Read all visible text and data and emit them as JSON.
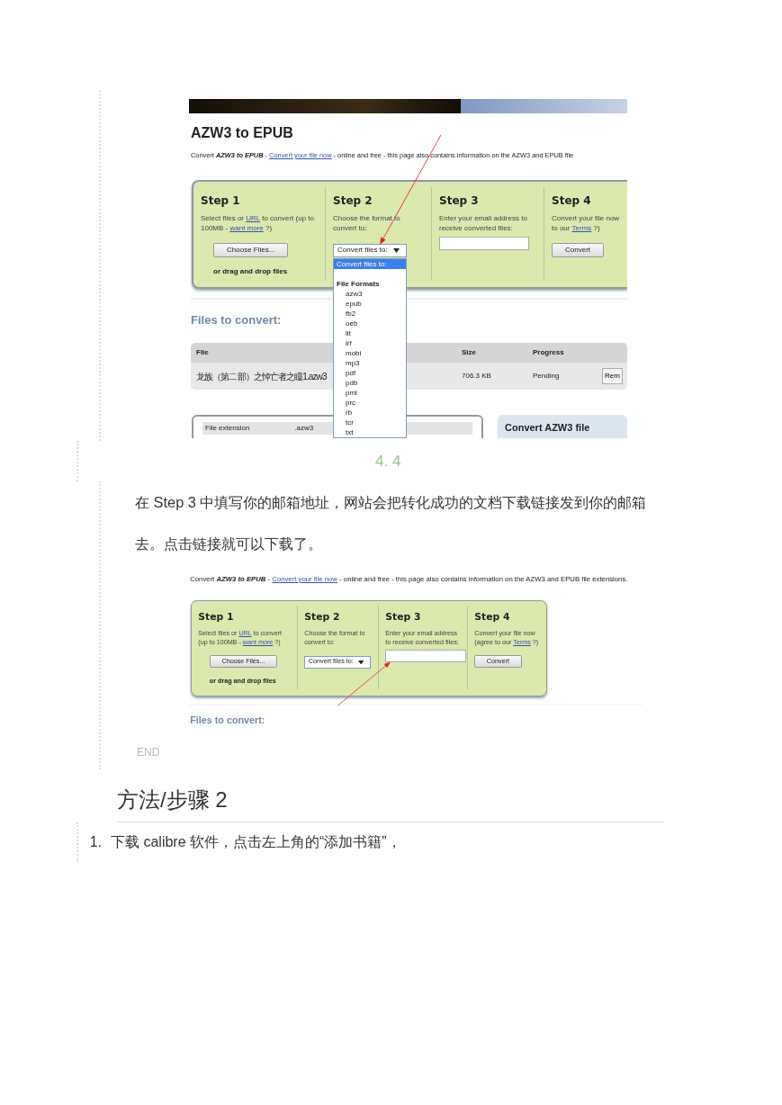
{
  "screenshot_1": {
    "title": "AZW3 to EPUB",
    "intro": {
      "before": "Convert **AZW3 to EPUB** - ",
      "link": "Convert your file now",
      "after": " - online and free - this page also contains information on the AZW3 and EPUB file"
    },
    "steps": [
      {
        "title": "Step 1",
        "text": [
          {
            "text": "Select files or ",
            "kind": "plain"
          },
          {
            "text": "URL",
            "kind": "link"
          },
          {
            "text": " to convert (up to 100MB - ",
            "kind": "plain"
          },
          {
            "text": "want more",
            "kind": "link"
          },
          {
            "text": " ?)",
            "kind": "plain"
          }
        ],
        "control": {
          "kind": "button",
          "label": "Choose Files..."
        },
        "note": "or drag and drop files"
      },
      {
        "title": "Step 2",
        "text": [
          {
            "text": "Choose the format to convert to:",
            "kind": "plain"
          }
        ],
        "control": {
          "kind": "select",
          "value": "Convert files to:"
        }
      },
      {
        "title": "Step 3",
        "text": [
          {
            "text": "Enter your email address to receive converted files:",
            "kind": "plain"
          }
        ],
        "control": {
          "kind": "input"
        }
      },
      {
        "title": "Step 4",
        "text": [
          {
            "text": "Convert your file now to our ",
            "kind": "plain"
          },
          {
            "text": "Terms",
            "kind": "link"
          },
          {
            "text": " ?)",
            "kind": "plain"
          }
        ],
        "control": {
          "kind": "button",
          "label": "Convert"
        }
      }
    ],
    "dropdown": {
      "items": [
        {
          "kind": "option",
          "label": "Convert files to:",
          "selected": true
        },
        {
          "kind": "group",
          "label": "File Formats"
        },
        {
          "kind": "format",
          "label": "azw3",
          "selected": false
        },
        {
          "kind": "format",
          "label": "epub",
          "selected": false
        },
        {
          "kind": "format",
          "label": "fb2",
          "selected": false
        },
        {
          "kind": "format",
          "label": "oeb",
          "selected": false
        },
        {
          "kind": "format",
          "label": "lit",
          "selected": false
        },
        {
          "kind": "format",
          "label": "lrf",
          "selected": false
        },
        {
          "kind": "format",
          "label": "mobi",
          "selected": false
        },
        {
          "kind": "format",
          "label": "mp3",
          "selected": false
        },
        {
          "kind": "format",
          "label": "pdf",
          "selected": false
        },
        {
          "kind": "format",
          "label": "pdb",
          "selected": false
        },
        {
          "kind": "format",
          "label": "pml",
          "selected": false
        },
        {
          "kind": "format",
          "label": "prc",
          "selected": false
        },
        {
          "kind": "format",
          "label": "rb",
          "selected": false
        },
        {
          "kind": "format",
          "label": "tcr",
          "selected": false
        },
        {
          "kind": "format",
          "label": "txt",
          "selected": false
        }
      ]
    },
    "files_heading": "Files to convert:",
    "table": {
      "columns": [
        "File",
        "Size",
        "Progress"
      ],
      "rows": [
        {
          "file": "龙族（第二部）之悼亡者之瞳1.azw3",
          "size": "706.3 KB",
          "progress": "Pending",
          "action": "Rem"
        }
      ]
    },
    "details": {
      "label": "File extension",
      "value": ".azw3"
    },
    "side_box_title": "Convert AZW3 file"
  },
  "step_label": "4. 4",
  "paragraph": "在 Step 3  中填写你的邮箱地址，网站会把转化成功的文档下载链接发到你的邮箱去。点击链接就可以下载了。",
  "screenshot_2": {
    "intro": {
      "before": "Convert **AZW3 to EPUB** - ",
      "link": "Convert your file now",
      "after": " - online and free - this page also contains information on the AZW3 and EPUB file extensions."
    },
    "steps": [
      {
        "title": "Step 1",
        "text": [
          {
            "text": "Select files or ",
            "kind": "plain"
          },
          {
            "text": "URL",
            "kind": "link"
          },
          {
            "text": " to convert (up to 100MB - ",
            "kind": "plain"
          },
          {
            "text": "want more",
            "kind": "link"
          },
          {
            "text": " ?)",
            "kind": "plain"
          }
        ],
        "control": {
          "kind": "button",
          "label": "Choose Files..."
        },
        "note": "or drag and drop files"
      },
      {
        "title": "Step 2",
        "text": [
          {
            "text": "Choose the format to convert to:",
            "kind": "plain"
          }
        ],
        "control": {
          "kind": "select",
          "value": "Convert files to:"
        }
      },
      {
        "title": "Step 3",
        "text": [
          {
            "text": "Enter your email address to receive converted files:",
            "kind": "plain"
          }
        ],
        "control": {
          "kind": "input"
        }
      },
      {
        "title": "Step 4",
        "text": [
          {
            "text": "Convert your file now (agree to our ",
            "kind": "plain"
          },
          {
            "text": "Terms",
            "kind": "link"
          },
          {
            "text": " ?)",
            "kind": "plain"
          }
        ],
        "control": {
          "kind": "button",
          "label": "Convert"
        }
      }
    ],
    "files_heading": "Files to convert:"
  },
  "end_label": "END",
  "section_title": "方法/步骤 2",
  "list_items": [
    {
      "number": "1.",
      "text": "下载 calibre 软件，点击左上角的“添加书籍”，"
    }
  ]
}
